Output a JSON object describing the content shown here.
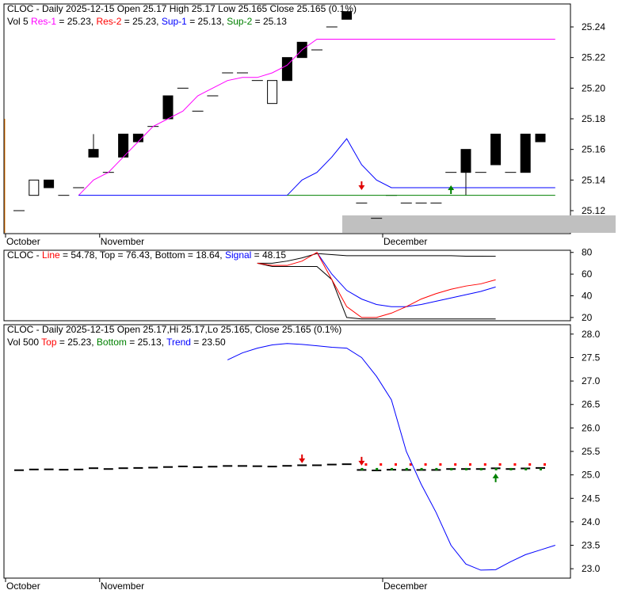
{
  "colors": {
    "res1": "#ff00ff",
    "res2": "#ff0000",
    "sup1": "#0000ff",
    "sup2": "#008000"
  },
  "chart_data": [
    {
      "type": "candlestick",
      "title": "CLOC - Daily 2025-12-15 Open 25.17  High 25.17  Low 25.165  Close 25.165 (0.1%)",
      "legend": {
        "vol": "Vol 5",
        "res1": "Res-1",
        "res1_val": " = 25.23, ",
        "res2": "Res-2",
        "res2_val": " = 25.23, ",
        "sup1": "Sup-1",
        "sup1_val": " = 25.13, ",
        "sup2": "Sup-2",
        "sup2_val": " = 25.13"
      },
      "yticks": [
        25.24,
        25.22,
        25.2,
        25.18,
        25.16,
        25.14,
        25.12
      ],
      "ylim": [
        25.105,
        25.255
      ],
      "xlabels": [
        {
          "label": "October",
          "i": -0.8
        },
        {
          "label": "November",
          "i": 6
        },
        {
          "label": "December",
          "i": 25
        }
      ],
      "ohlc": [
        [
          25.12,
          25.12,
          25.12,
          25.12
        ],
        [
          25.13,
          25.14,
          25.13,
          25.14
        ],
        [
          25.14,
          25.14,
          25.135,
          25.135
        ],
        [
          25.13,
          25.13,
          25.13,
          25.13
        ],
        [
          25.135,
          25.135,
          25.135,
          25.135
        ],
        [
          25.16,
          25.17,
          25.155,
          25.155
        ],
        [
          25.145,
          25.145,
          25.145,
          25.145
        ],
        [
          25.17,
          25.17,
          25.155,
          25.155
        ],
        [
          25.17,
          25.17,
          25.165,
          25.165
        ],
        [
          25.175,
          25.175,
          25.175,
          25.175
        ],
        [
          25.195,
          25.195,
          25.18,
          25.18
        ],
        [
          25.2,
          25.2,
          25.2,
          25.2
        ],
        [
          25.185,
          25.185,
          25.185,
          25.185
        ],
        [
          25.195,
          25.195,
          25.195,
          25.195
        ],
        [
          25.21,
          25.21,
          25.21,
          25.21
        ],
        [
          25.21,
          25.21,
          25.21,
          25.21
        ],
        [
          25.205,
          25.205,
          25.205,
          25.205
        ],
        [
          25.19,
          25.205,
          25.19,
          25.205
        ],
        [
          25.22,
          25.22,
          25.205,
          25.205
        ],
        [
          25.23,
          25.23,
          25.22,
          25.22
        ],
        [
          25.225,
          25.225,
          25.225,
          25.225
        ],
        [
          25.24,
          25.24,
          25.24,
          25.24
        ],
        [
          25.25,
          25.25,
          25.245,
          25.245
        ],
        [
          25.125,
          25.125,
          25.125,
          25.125
        ],
        [
          25.115,
          25.115,
          25.115,
          25.115
        ],
        [
          25.13,
          25.13,
          25.13,
          25.13
        ],
        [
          25.125,
          25.125,
          25.125,
          25.125
        ],
        [
          25.125,
          25.125,
          25.125,
          25.125
        ],
        [
          25.125,
          25.125,
          25.125,
          25.125
        ],
        [
          25.145,
          25.145,
          25.145,
          25.145
        ],
        [
          25.16,
          25.16,
          25.13,
          25.145
        ],
        [
          25.145,
          25.145,
          25.145,
          25.145
        ],
        [
          25.17,
          25.17,
          25.15,
          25.15
        ],
        [
          25.145,
          25.145,
          25.145,
          25.145
        ],
        [
          25.17,
          25.17,
          25.145,
          25.145
        ],
        [
          25.17,
          25.17,
          25.165,
          25.165
        ]
      ],
      "res1": {
        "start": 4,
        "values": [
          25.13,
          25.14,
          25.145,
          25.155,
          25.165,
          25.175,
          25.18,
          25.185,
          25.195,
          25.2,
          25.205,
          25.207,
          25.207,
          25.21,
          25.215,
          25.225,
          25.232,
          25.232,
          25.232,
          25.232,
          25.232,
          25.232,
          25.232,
          25.232,
          25.232,
          25.232,
          25.232,
          25.232,
          25.232,
          25.232,
          25.232,
          25.232,
          25.232
        ]
      },
      "sup1": {
        "start": 4,
        "values": [
          25.13,
          25.13,
          25.13,
          25.13,
          25.13,
          25.13,
          25.13,
          25.13,
          25.13,
          25.13,
          25.13,
          25.13,
          25.13,
          25.13,
          25.13,
          25.14,
          25.145,
          25.155,
          25.167,
          25.15,
          25.14,
          25.135,
          25.135,
          25.135,
          25.135,
          25.135,
          25.135,
          25.135,
          25.135,
          25.135,
          25.135,
          25.135,
          25.135
        ]
      },
      "sup2": {
        "start": 18,
        "values": [
          25.13,
          25.13,
          25.13,
          25.13,
          25.13,
          25.13,
          25.13,
          25.13,
          25.13,
          25.13,
          25.13,
          25.13,
          25.13,
          25.13,
          25.13,
          25.13,
          25.13,
          25.13,
          25.13
        ]
      },
      "arrows": [
        {
          "i": 23,
          "dir": "down",
          "v": 25.135
        },
        {
          "i": 29,
          "dir": "up",
          "v": 25.135
        }
      ]
    },
    {
      "type": "line",
      "legend": {
        "name": "CLOC - ",
        "line": "Line",
        "line_val": " = 54.78, Top = 76.43, Bottom = 18.64, ",
        "signal": "Signal",
        "signal_val": " = 48.15"
      },
      "yticks": [
        80,
        60,
        40,
        20
      ],
      "ylim": [
        17,
        82
      ],
      "line": {
        "start": 16,
        "values": [
          70,
          68,
          68,
          72,
          80,
          55,
          30,
          20,
          20,
          24,
          30,
          37,
          42,
          46,
          49,
          51,
          54.78
        ]
      },
      "signal": {
        "start": 20,
        "values": [
          80,
          60,
          45,
          37,
          32,
          30,
          30,
          32,
          35,
          38,
          41,
          44,
          48.15
        ]
      },
      "top": {
        "start": 16,
        "values": [
          70,
          70,
          72,
          75,
          79,
          78,
          77,
          77,
          77,
          77,
          77,
          77,
          77,
          77,
          76.5,
          76.5,
          76.43
        ]
      },
      "bottom": {
        "start": 16,
        "values": [
          70,
          67,
          67,
          67,
          67,
          55,
          20,
          18.64,
          18.64,
          18.64,
          18.64,
          18.64,
          18.64,
          18.64,
          18.64,
          18.64,
          18.64
        ]
      }
    },
    {
      "type": "line",
      "title": "CLOC - Daily 2025-12-15 Open 25.17,Hi 25.17,Lo 25.165, Close 25.165 (0.1%)",
      "legend": {
        "vol": "Vol 500 ",
        "top": "Top",
        "top_val": " = 25.23, ",
        "bottom": "Bottom",
        "bottom_val": " = 25.13, ",
        "trend": "Trend",
        "trend_val": " = 23.50"
      },
      "yticks": [
        28.0,
        27.5,
        27.0,
        26.5,
        26.0,
        25.5,
        25.0,
        24.5,
        24.0,
        23.5,
        23.0
      ],
      "ylim": [
        22.8,
        28.2
      ],
      "xlabels": [
        {
          "label": "October",
          "i": -0.8
        },
        {
          "label": "November",
          "i": 6
        },
        {
          "label": "December",
          "i": 25
        }
      ],
      "trend": {
        "start": 14,
        "values": [
          27.45,
          27.6,
          27.7,
          27.77,
          27.8,
          27.78,
          27.75,
          27.72,
          27.7,
          27.5,
          27.1,
          26.6,
          25.5,
          24.8,
          24.2,
          23.5,
          23.1,
          22.97,
          22.98,
          23.15,
          23.3,
          23.4,
          23.5
        ]
      },
      "top_dots_start": 23,
      "top_value": 25.23,
      "bottom_value": 25.13,
      "arrows": [
        {
          "i": 19,
          "dir": "down",
          "v": 25.3
        },
        {
          "i": 23,
          "dir": "down",
          "v": 25.25
        },
        {
          "i": 32,
          "dir": "up",
          "v": 24.98
        }
      ]
    }
  ]
}
